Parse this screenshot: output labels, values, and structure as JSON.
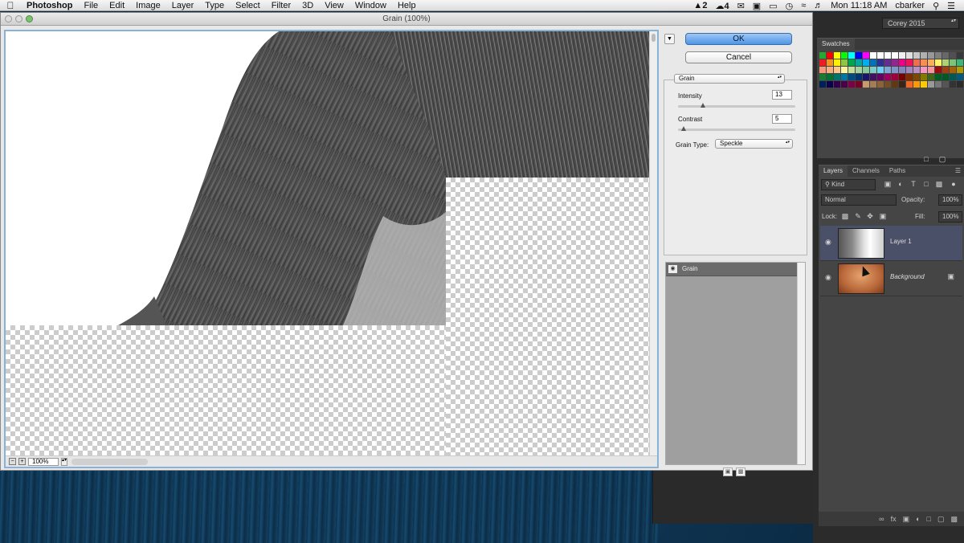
{
  "menubar": {
    "app_name": "Photoshop",
    "items": [
      "File",
      "Edit",
      "Image",
      "Layer",
      "Type",
      "Select",
      "Filter",
      "3D",
      "View",
      "Window",
      "Help"
    ],
    "status": {
      "adobe_count": "2",
      "cc_count": "4",
      "clock": "Mon 11:18 AM",
      "user": "cbarker"
    }
  },
  "window": {
    "title": "Grain (100%)"
  },
  "preview": {
    "zoom": "100%"
  },
  "dialog": {
    "ok_label": "OK",
    "cancel_label": "Cancel",
    "filter_select": "Grain",
    "params": {
      "intensity_label": "Intensity",
      "intensity_value": "13",
      "intensity_fraction": 0.13,
      "contrast_label": "Contrast",
      "contrast_value": "5",
      "contrast_fraction": 0.05,
      "grain_type_label": "Grain Type:",
      "grain_type_value": "Speckle"
    },
    "effect_layers": [
      "Grain"
    ]
  },
  "workspace": {
    "name": "Corey 2015"
  },
  "swatches_panel": {
    "tab": "Swatches",
    "colors": [
      "#22aa33",
      "#ff0000",
      "#ffff00",
      "#00ff00",
      "#00ffff",
      "#0000ff",
      "#ff00ff",
      "#ffffff",
      "#ffffff",
      "#ffffff",
      "#ffffff",
      "#f0f0f0",
      "#e0e0e0",
      "#c8c8c8",
      "#b0b0b0",
      "#989898",
      "#808080",
      "#686868",
      "#505050",
      "#383838",
      "#000000",
      "#ed1c24",
      "#f7941d",
      "#fff200",
      "#8dc63f",
      "#00a651",
      "#00a99d",
      "#00aeef",
      "#0072bc",
      "#2e3192",
      "#662d91",
      "#92278f",
      "#ec008c",
      "#ed145b",
      "#f26c4f",
      "#f68e56",
      "#fbaf5d",
      "#fff568",
      "#acd372",
      "#7cc576",
      "#3bb878",
      "#1abbb4",
      "#f7977a",
      "#f9ad81",
      "#fdc68a",
      "#fff79a",
      "#c4df9b",
      "#a3d39c",
      "#82ca9d",
      "#7bcdc8",
      "#6ecff6",
      "#7ea7d8",
      "#8493ca",
      "#8882be",
      "#a187be",
      "#bc8dbf",
      "#f49ac2",
      "#f6989d",
      "#9e0b0f",
      "#a0410d",
      "#a36209",
      "#aba000",
      "#598527",
      "#1a7b30",
      "#007236",
      "#00746b",
      "#0076a3",
      "#004b80",
      "#003471",
      "#1b1464",
      "#440e62",
      "#630460",
      "#9e005d",
      "#9e0039",
      "#790000",
      "#7b2e00",
      "#7d4900",
      "#827b00",
      "#406618",
      "#005e20",
      "#005826",
      "#005952",
      "#005b7f",
      "#003663",
      "#002157",
      "#0d004c",
      "#32004b",
      "#4b0049",
      "#7b0046",
      "#7a0026",
      "#c69c6d",
      "#a67c52",
      "#8c6239",
      "#754c24",
      "#603913",
      "#3c2415",
      "#f26522",
      "#ff9900",
      "#ffcc00",
      "#999999",
      "#777777",
      "#555555",
      "#333333",
      "#2b2b2b",
      "#2b2b2b"
    ]
  },
  "layers_panel": {
    "tabs": [
      "Layers",
      "Channels",
      "Paths"
    ],
    "filter_kind": "Kind",
    "blend_mode": "Normal",
    "opacity_label": "Opacity:",
    "opacity_value": "100%",
    "lock_label": "Lock:",
    "fill_label": "Fill:",
    "fill_value": "100%",
    "layers": [
      {
        "name": "Layer 1",
        "selected": true,
        "italic": false
      },
      {
        "name": "Background",
        "selected": false,
        "italic": true
      }
    ]
  }
}
